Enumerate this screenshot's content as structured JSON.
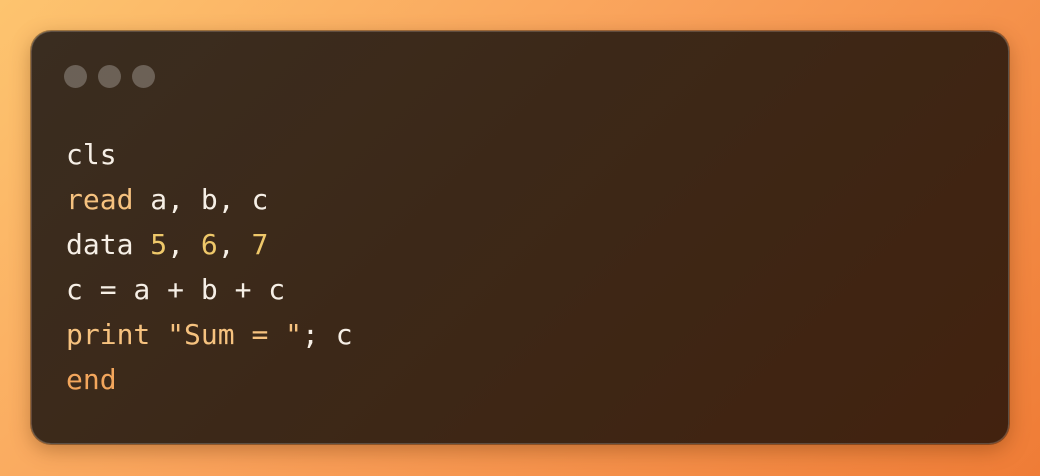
{
  "window": {
    "controls": [
      "close-dot",
      "minimize-dot",
      "maximize-dot"
    ]
  },
  "code": {
    "line1": {
      "kw": "cls"
    },
    "line2": {
      "kw": "read",
      "rest": " a, b, c"
    },
    "line3": {
      "kw": "data",
      "sp": " ",
      "n1": "5",
      "c1": ", ",
      "n2": "6",
      "c2": ", ",
      "n3": "7"
    },
    "line4": {
      "text": "c = a + b + c"
    },
    "line5": {
      "kw": "print",
      "sp": " ",
      "str": "\"Sum = \"",
      "rest": "; c"
    },
    "line6": {
      "kw": "end"
    }
  },
  "colors": {
    "background_start": "#fdc46f",
    "background_end": "#ef7c36",
    "window_bg": "#3d2716",
    "text": "#f6efe6",
    "keyword": "#f6c27f",
    "number": "#efc86a",
    "end_keyword": "#f3a65c"
  }
}
